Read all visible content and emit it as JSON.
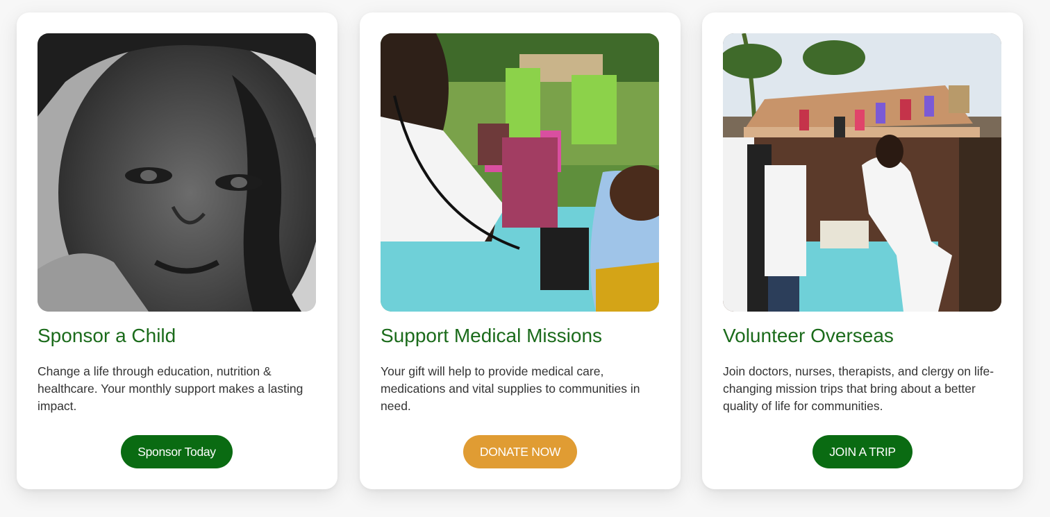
{
  "cards": [
    {
      "title": "Sponsor a Child",
      "body": "Change a life through education, nutrition & healthcare. Your monthly support makes a lasting impact.",
      "button_label": "Sponsor Today",
      "image": "child-portrait-photo"
    },
    {
      "title": "Support Medical Missions",
      "body": "Your gift will help to provide medical care, medications and vital supplies to communities in need.",
      "button_label": "DONATE NOW",
      "image": "medical-checkup-photo"
    },
    {
      "title": "Volunteer Overseas",
      "body": "Join doctors, nurses, therapists, and clergy on life-changing mission trips that bring about a better quality of life for communities.",
      "button_label": "JOIN A TRIP",
      "image": "volunteer-school-supplies-photo"
    }
  ],
  "colors": {
    "title_green": "#1b6b1b",
    "button_green": "#0a6b12",
    "button_gold": "#e09c33",
    "body_text": "#333333"
  }
}
